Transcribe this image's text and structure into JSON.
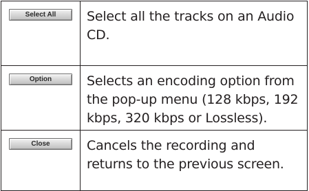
{
  "rows": [
    {
      "button_label": "Select All",
      "description": "Select all the tracks on an Audio CD."
    },
    {
      "button_label": "Option",
      "description": "Selects an encoding option from the pop-up menu (128 kbps, 192 kbps, 320 kbps or Lossless)."
    },
    {
      "button_label": "Close",
      "description": "Cancels the recording and returns to the previous screen."
    }
  ]
}
